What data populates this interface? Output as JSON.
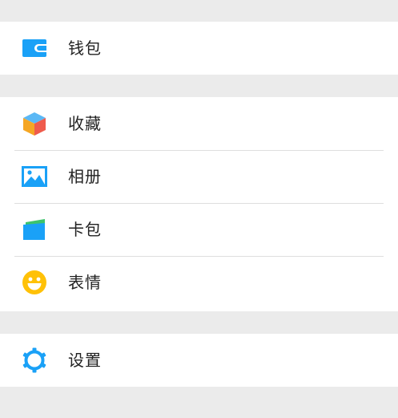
{
  "groups": [
    {
      "items": [
        {
          "label": "钱包",
          "icon": "wallet-icon"
        }
      ]
    },
    {
      "items": [
        {
          "label": "收藏",
          "icon": "cube-icon"
        },
        {
          "label": "相册",
          "icon": "photo-album-icon"
        },
        {
          "label": "卡包",
          "icon": "card-package-icon"
        },
        {
          "label": "表情",
          "icon": "smiley-icon"
        }
      ]
    },
    {
      "items": [
        {
          "label": "设置",
          "icon": "gear-icon"
        }
      ]
    }
  ],
  "colors": {
    "wallet": "#1aa1f7",
    "cube_top": "#5bb8f5",
    "cube_left": "#f5a623",
    "cube_right": "#ef5b4c",
    "album": "#1aa1f7",
    "card_front": "#1aa1f7",
    "card_back": "#3dc46b",
    "smiley": "#ffc107",
    "gear": "#1aa1f7",
    "background": "#ebebeb"
  }
}
